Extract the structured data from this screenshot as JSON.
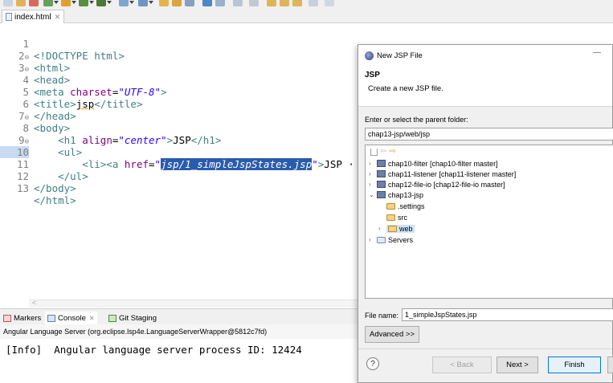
{
  "editor_tab": {
    "label": "index.html",
    "close": "✕"
  },
  "editor": {
    "active_line": "10",
    "lines": [
      {
        "n": "1",
        "fold": ""
      },
      {
        "n": "2",
        "fold": "⊖"
      },
      {
        "n": "3",
        "fold": "⊖"
      },
      {
        "n": "4",
        "fold": ""
      },
      {
        "n": "5",
        "fold": ""
      },
      {
        "n": "6",
        "fold": ""
      },
      {
        "n": "7",
        "fold": "⊖"
      },
      {
        "n": "8",
        "fold": ""
      },
      {
        "n": "9",
        "fold": "⊖"
      },
      {
        "n": "10",
        "fold": ""
      },
      {
        "n": "11",
        "fold": ""
      },
      {
        "n": "12",
        "fold": ""
      },
      {
        "n": "13",
        "fold": ""
      }
    ],
    "code": {
      "l1": "<!DOCTYPE html>",
      "l2": "<html>",
      "l3": "<head>",
      "l4_tag": "<meta ",
      "l4_attr": "charset",
      "l4_eq": "=",
      "l4_val": "\"UTF-8\"",
      "l4_end": ">",
      "l5_open": "<title>",
      "l5_text": "jsp",
      "l5_close": "</title>",
      "l6": "</head>",
      "l7": "<body>",
      "l8_open": "<h1 ",
      "l8_attr": "align",
      "l8_eq": "=",
      "l8_val": "\"center\"",
      "l8_gt": ">",
      "l8_text": "JSP",
      "l8_close": "</h1>",
      "l9": "<ul>",
      "l10_li": "<li>",
      "l10_a": "<a ",
      "l10_attr": "href",
      "l10_eq": "=",
      "l10_q1": "\"",
      "l10_sel": "jsp/1_simpleJspStates.jsp",
      "l10_q2": "\"",
      "l10_gt": ">",
      "l10_text": "JSP ·",
      "l11": "</ul>",
      "l12": "</body>",
      "l13": "</html>"
    },
    "scroll_left": "<"
  },
  "bottom_panel": {
    "tabs": [
      {
        "label": "Markers"
      },
      {
        "label": "Console"
      },
      {
        "label": "Git Staging"
      }
    ],
    "console_close": "✕",
    "console_title": "Angular Language Server (org.eclipse.lsp4e.LanguageServerWrapper@5812c7fd)",
    "console_output": "[Info]  Angular language server process ID: 12424"
  },
  "dialog": {
    "title": "New JSP File",
    "minimize": "—",
    "header_title": "JSP",
    "header_subtitle": "Create a new JSP file.",
    "parent_label": "Enter or select the parent folder:",
    "parent_value": "chap13-jsp/web/jsp",
    "tree": [
      {
        "label": "chap10-filter [chap10-filter master]",
        "twisty": "›",
        "icon": "project"
      },
      {
        "label": "chap11-listener [chap11-listener master]",
        "twisty": "›",
        "icon": "project"
      },
      {
        "label": "chap12-file-io [chap12-file-io master]",
        "twisty": "›",
        "icon": "project"
      },
      {
        "label": "chap13-jsp",
        "twisty": "⌄",
        "icon": "project"
      },
      {
        "label": ".settings",
        "twisty": "",
        "icon": "folder"
      },
      {
        "label": "src",
        "twisty": "",
        "icon": "folder"
      },
      {
        "label": "web",
        "twisty": "›",
        "icon": "folder"
      },
      {
        "label": "Servers",
        "twisty": "›",
        "icon": "folder"
      }
    ],
    "file_name_label": "File name:",
    "file_name_value": "1_simpleJspStates.jsp",
    "advanced_label": "Advanced >>",
    "help": "?",
    "back_label": "< Back",
    "next_label": "Next >",
    "finish_label": "Finish"
  }
}
